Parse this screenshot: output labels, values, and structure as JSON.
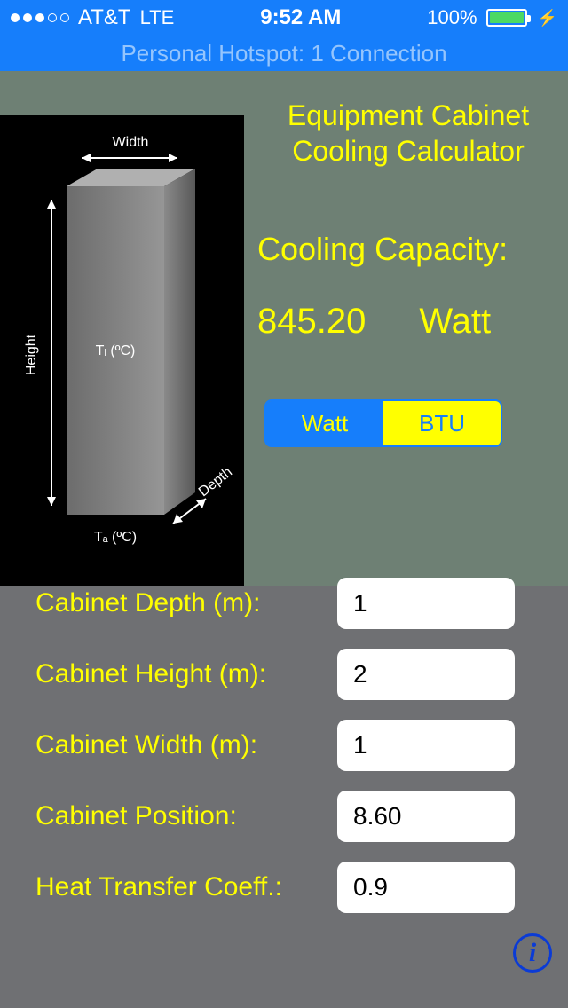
{
  "status": {
    "carrier": "AT&T",
    "network": "LTE",
    "time": "9:52 AM",
    "battery_pct": "100%"
  },
  "hotspot": "Personal Hotspot: 1 Connection",
  "title_line1": "Equipment Cabinet",
  "title_line2": "Cooling Calculator",
  "capacity_label": "Cooling Capacity:",
  "capacity_value": "845.20",
  "capacity_unit": "Watt",
  "segments": {
    "watt": "Watt",
    "btu": "BTU"
  },
  "diagram": {
    "width_label": "Width",
    "height_label": "Height",
    "depth_label": "Depth",
    "ti_label": "Tᵢ (ºC)",
    "ta_label": "Tₐ (ºC)"
  },
  "form": {
    "depth": {
      "label": "Cabinet Depth (m):",
      "value": "1"
    },
    "height": {
      "label": "Cabinet Height (m):",
      "value": "2"
    },
    "width": {
      "label": "Cabinet Width (m):",
      "value": "1"
    },
    "position": {
      "label": "Cabinet Position:",
      "value": "8.60"
    },
    "coeff": {
      "label": "Heat Transfer Coeff.:",
      "value": "0.9"
    }
  },
  "info_glyph": "i"
}
